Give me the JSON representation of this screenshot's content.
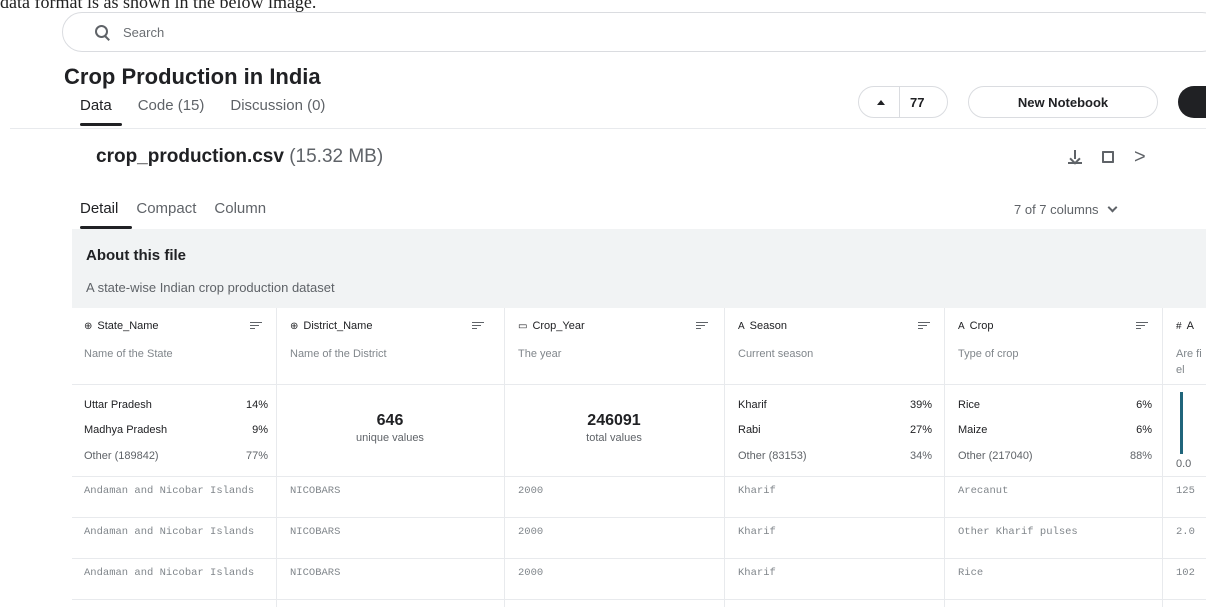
{
  "caption": "data format is as shown in the below image.",
  "search": {
    "placeholder": "Search"
  },
  "page_title": "Crop Production in India",
  "tabs": [
    {
      "label": "Data",
      "active": true
    },
    {
      "label": "Code (15)",
      "active": false
    },
    {
      "label": "Discussion (0)",
      "active": false
    }
  ],
  "vote": {
    "count": "77"
  },
  "new_notebook_label": "New Notebook",
  "file": {
    "name": "crop_production.csv",
    "size": "(15.32 MB)"
  },
  "subtabs": [
    {
      "label": "Detail",
      "active": true
    },
    {
      "label": "Compact",
      "active": false
    },
    {
      "label": "Column",
      "active": false
    }
  ],
  "columns_select": "7 of 7 columns",
  "about": {
    "title": "About this file",
    "description": "A state-wise Indian crop production dataset"
  },
  "columns": [
    {
      "type_icon": "globe-icon",
      "glyph": "⊕",
      "name": "State_Name",
      "description": "Name of the State",
      "stats": [
        {
          "label": "Uttar Pradesh",
          "pct": "14%"
        },
        {
          "label": "Madhya Pradesh",
          "pct": "9%"
        },
        {
          "label": "Other (189842)",
          "pct": "77%"
        }
      ]
    },
    {
      "type_icon": "globe-icon",
      "glyph": "⊕",
      "name": "District_Name",
      "description": "Name of the District",
      "big": {
        "num": "646",
        "label": "unique values"
      }
    },
    {
      "type_icon": "calendar-icon",
      "glyph": "▭",
      "name": "Crop_Year",
      "description": "The year",
      "big": {
        "num": "246091",
        "label": "total values"
      }
    },
    {
      "type_icon": "string-icon",
      "glyph": "A",
      "name": "Season",
      "description": "Current season",
      "stats": [
        {
          "label": "Kharif",
          "pct": "39%"
        },
        {
          "label": "Rabi",
          "pct": "27%"
        },
        {
          "label": "Other (83153)",
          "pct": "34%"
        }
      ]
    },
    {
      "type_icon": "string-icon",
      "glyph": "A",
      "name": "Crop",
      "description": "Type of crop",
      "stats": [
        {
          "label": "Rice",
          "pct": "6%"
        },
        {
          "label": "Maize",
          "pct": "6%"
        },
        {
          "label": "Other (217040)",
          "pct": "88%"
        }
      ]
    },
    {
      "type_icon": "hash-icon",
      "glyph": "#",
      "name": "A",
      "description": "Are fiel",
      "hist_axis": "0.0"
    }
  ],
  "rows": [
    [
      "Andaman and Nicobar Islands",
      "NICOBARS",
      "2000",
      "Kharif",
      "Arecanut",
      "125"
    ],
    [
      "Andaman and Nicobar Islands",
      "NICOBARS",
      "2000",
      "Kharif",
      "Other Kharif pulses",
      "2.0"
    ],
    [
      "Andaman and Nicobar Islands",
      "NICOBARS",
      "2000",
      "Kharif",
      "Rice",
      "102"
    ]
  ]
}
